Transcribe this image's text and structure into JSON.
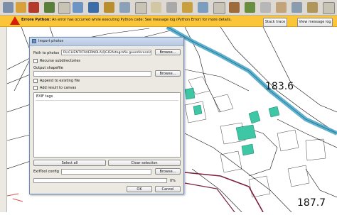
{
  "error_bar": {
    "title": "Errore Python:",
    "message": "An error has occurred while executing Python code: See message log (Python Error) for more details.",
    "stack_trace_label": "Stack trace",
    "view_log_label": "View message log"
  },
  "dialog": {
    "title": "Import photos",
    "path_label": "Path to photos",
    "path_value": "RL\\CLIENTI\\TAVERNOLA\\QGIS\\fotografie georeferenziate",
    "browse_label": "Browse...",
    "recurse_label": "Recurse subdirectories",
    "output_label": "Output shapefile",
    "append_label": "Append to existing file",
    "add_canvas_label": "Add result to canvas",
    "exif_label": "EXIF tags",
    "select_all_label": "Select all",
    "clear_selection_label": "Clear selection",
    "exiftool_label": "ExifTool config",
    "progress_text": "0%",
    "progress_value": 0,
    "ok_label": "OK",
    "cancel_label": "Cancel"
  },
  "map": {
    "elevation_label_1": "183.6",
    "elevation_label_2": "187.7"
  },
  "colors": {
    "error_bar": "#fbc53a",
    "river": "#4fa9c9",
    "building": "#3ec7a5",
    "road": "#7a1f3d"
  }
}
